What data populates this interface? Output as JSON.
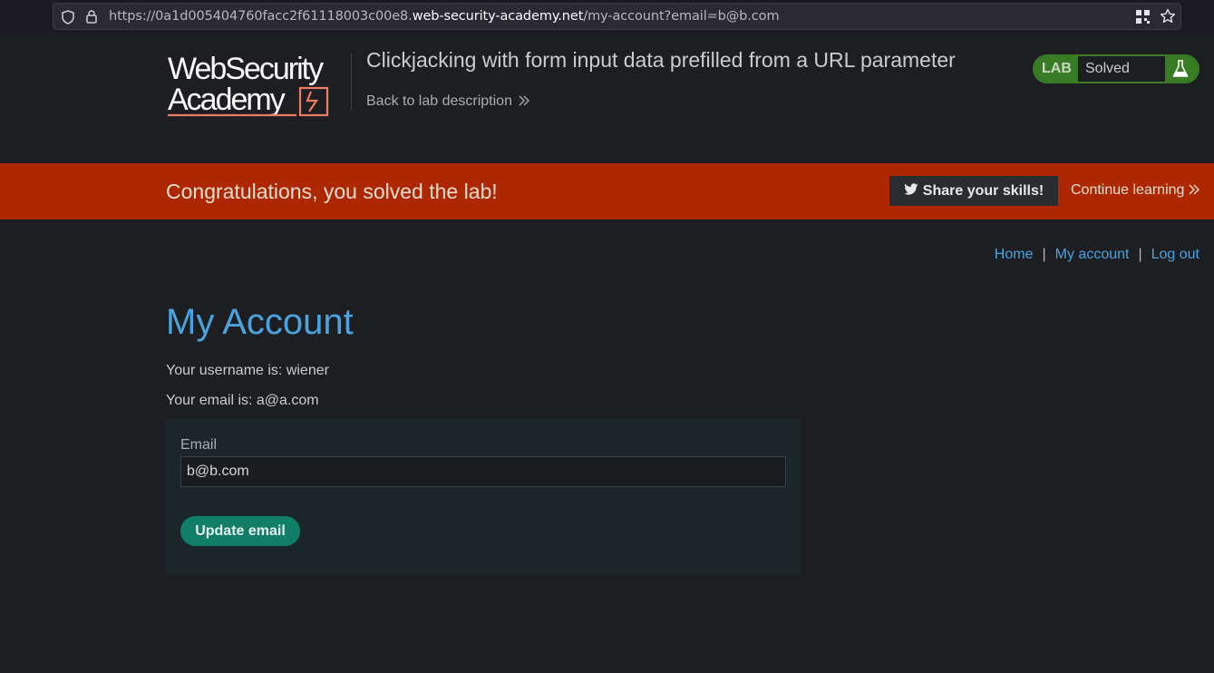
{
  "browser": {
    "url_prefix": "https://0a1d005404760facc2f61118003c00e8.",
    "url_host": "web-security-academy.net",
    "url_path": "/my-account?email=b@b.com"
  },
  "header": {
    "logo_line1": "WebSecurity",
    "logo_line2": "Academy",
    "lab_title": "Clickjacking with form input data prefilled from a URL parameter",
    "back_link": "Back to lab description",
    "status_tag": "LAB",
    "status_text": "Solved"
  },
  "banner": {
    "message": "Congratulations, you solved the lab!",
    "share_label": "Share your skills!",
    "continue_label": "Continue learning"
  },
  "nav": {
    "home": "Home",
    "separator": "|",
    "my_account": "My account",
    "log_out": "Log out"
  },
  "account": {
    "title": "My Account",
    "username_line": "Your username is: wiener",
    "email_line": "Your email is: a@a.com",
    "email_label": "Email",
    "email_value": "b@b.com",
    "update_label": "Update email"
  },
  "colors": {
    "background": "#1c1e21",
    "banner": "#ad2800",
    "link": "#4aa3df",
    "status_green": "#3a7b26",
    "button_teal": "#117e68"
  }
}
